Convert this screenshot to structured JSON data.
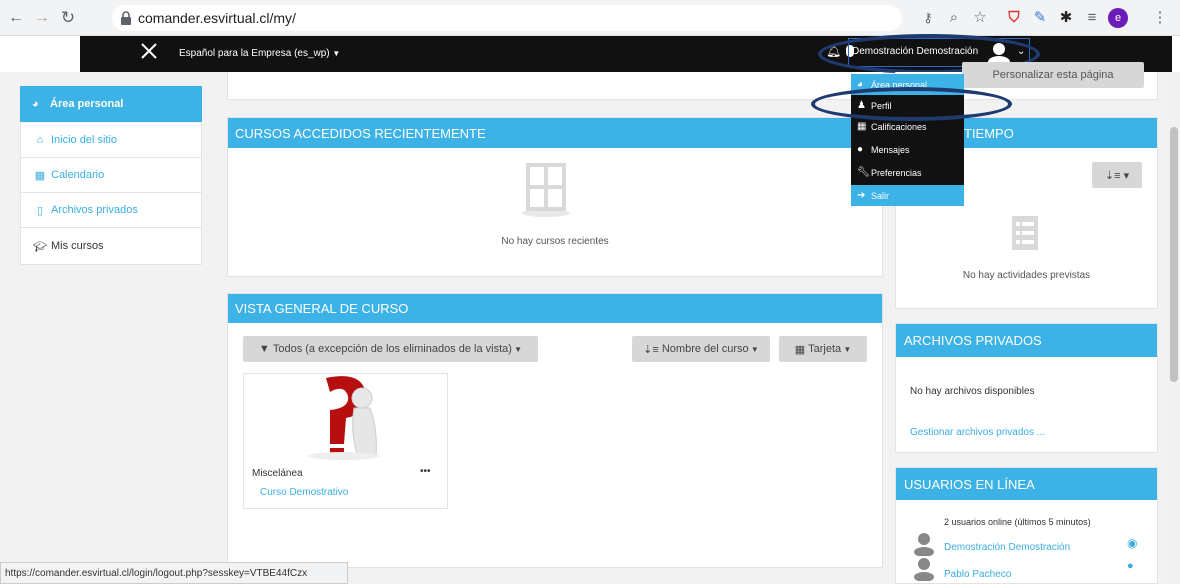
{
  "browser": {
    "url": "comander.esvirtual.cl/my/",
    "profile_initial": "e"
  },
  "navbar": {
    "site_title": "Español para la Empresa (es_wp)",
    "user_name": "Demostración Demostración"
  },
  "user_menu": {
    "items": [
      {
        "label": "Área personal",
        "icon": "dashboard-icon"
      },
      {
        "label": "Perfil",
        "icon": "user-icon"
      },
      {
        "label": "Calificaciones",
        "icon": "table-icon"
      },
      {
        "label": "Mensajes",
        "icon": "chat-icon"
      },
      {
        "label": "Preferencias",
        "icon": "wrench-icon"
      },
      {
        "label": "Salir",
        "icon": "signout-icon"
      }
    ],
    "customize_button": "Personalizar esta página"
  },
  "sidebar": {
    "items": [
      {
        "label": "Área personal",
        "icon": "dashboard-icon",
        "active": true
      },
      {
        "label": "Inicio del sitio",
        "icon": "home-icon"
      },
      {
        "label": "Calendario",
        "icon": "calendar-icon"
      },
      {
        "label": "Archivos privados",
        "icon": "file-icon"
      },
      {
        "label": "Mis cursos",
        "icon": "graduation-cap-icon"
      }
    ]
  },
  "recent_courses": {
    "title": "CURSOS ACCEDIDOS RECIENTEMENTE",
    "empty_text": "No hay cursos recientes"
  },
  "course_overview": {
    "title": "VISTA GENERAL DE CURSO",
    "filter_label": "Todos (a excepción de los eliminados de la vista)",
    "sort_label": "Nombre del curso",
    "view_label": "Tarjeta",
    "course": {
      "category": "Miscelánea",
      "name": "Curso Demostrativo",
      "menu": "•••"
    }
  },
  "timeline": {
    "title_visible": "TIEMPO",
    "empty_text": "No hay actividades previstas"
  },
  "private_files": {
    "title": "ARCHIVOS PRIVADOS",
    "empty_text": "No hay archivos disponibles",
    "manage_link": "Gestionar archivos privados ..."
  },
  "online_users": {
    "title": "USUARIOS EN LÍNEA",
    "summary": "2 usuarios online (últimos 5 minutos)",
    "users": [
      {
        "name": "Demostración Demostración"
      },
      {
        "name": "Pablo Pacheco"
      }
    ]
  },
  "status_bar": {
    "text": "https://comander.esvirtual.cl/login/logout.php?sesskey=VTBE44fCzx"
  },
  "colors": {
    "accent": "#3cb2e6",
    "navbar": "#111111",
    "oval": "#1f3a6e"
  }
}
